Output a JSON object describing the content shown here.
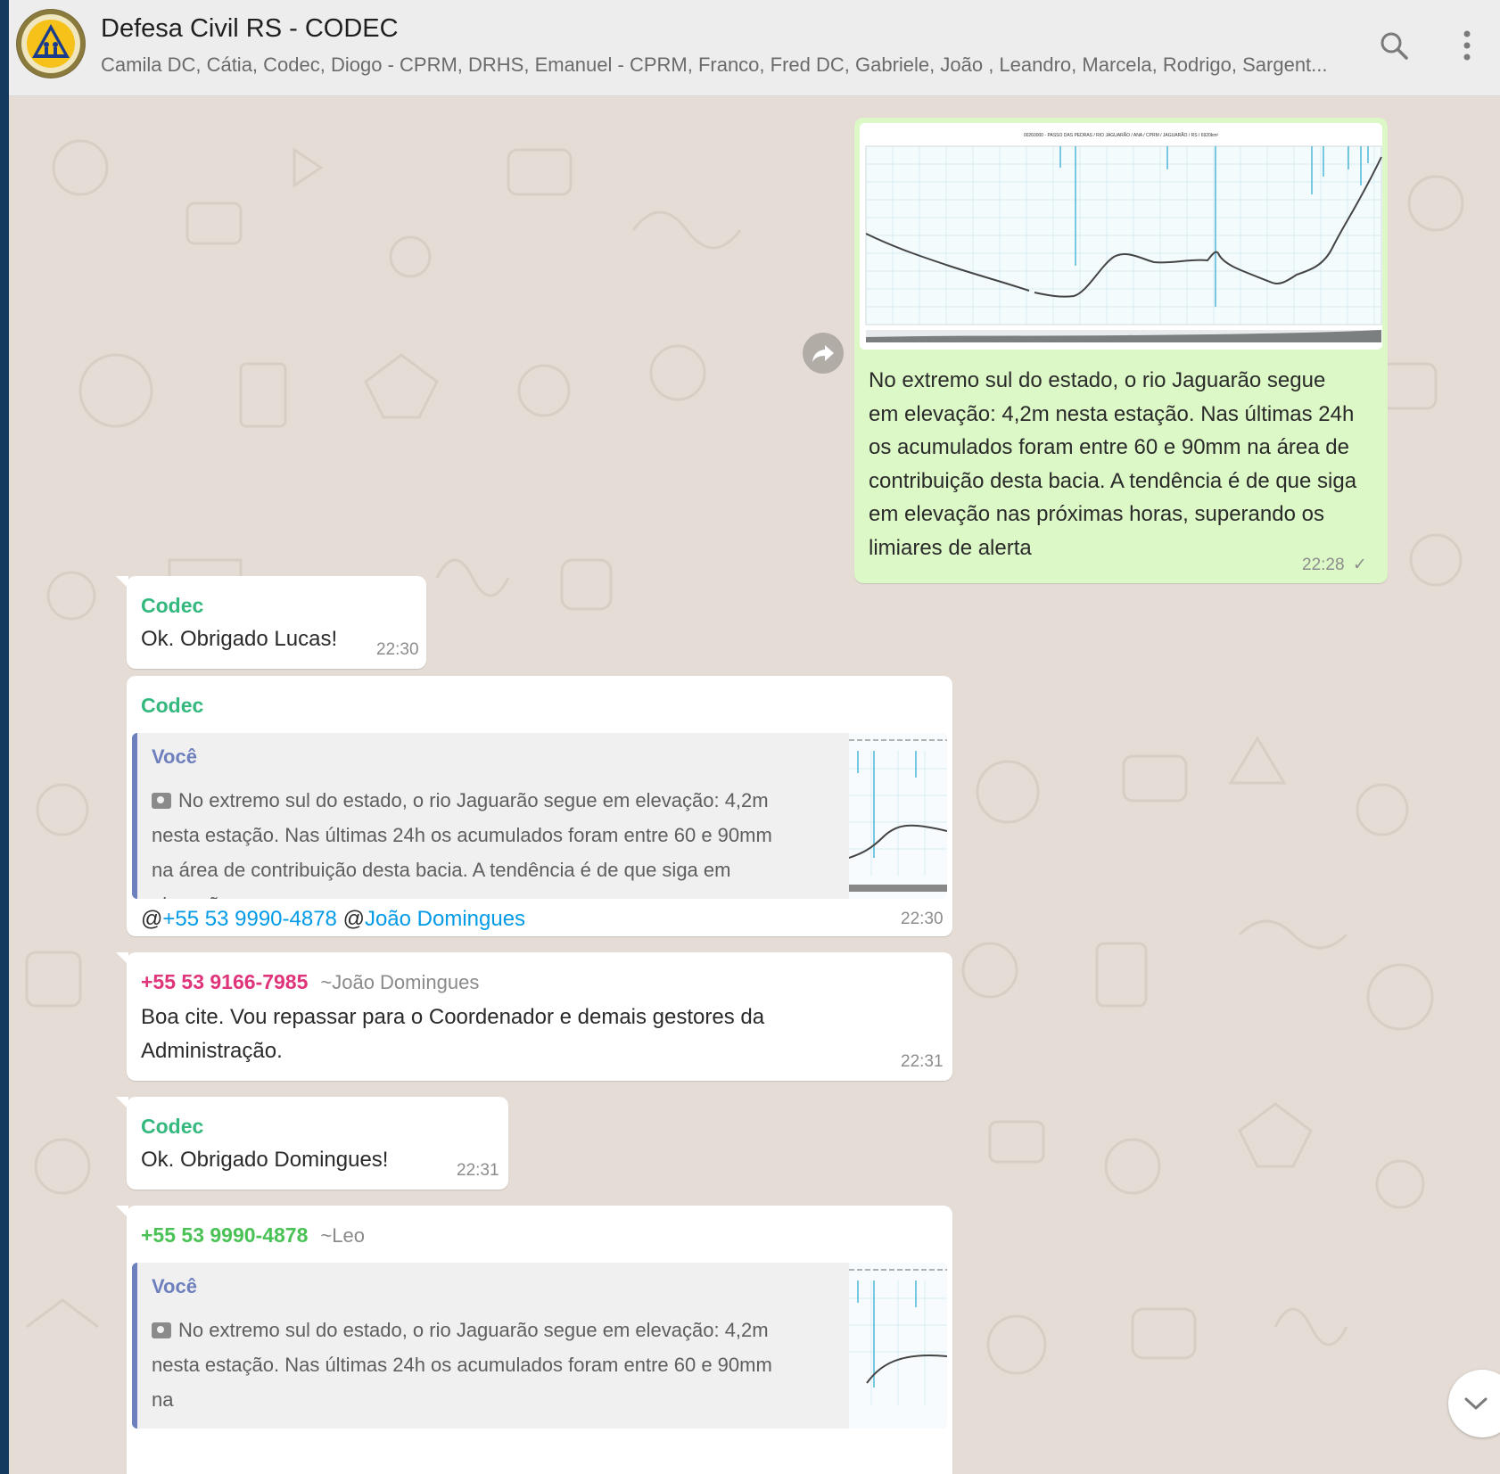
{
  "colors": {
    "header_bg": "#ededed",
    "chat_bg": "#e5ddd5",
    "outgoing_bubble": "#dcf8c6",
    "incoming_bubble": "#ffffff",
    "sender_codec": "#35b87e",
    "sender_pink": "#e0347a",
    "sender_green": "#4ac255",
    "mention": "#039be5",
    "quote_author": "#6d7fbd"
  },
  "header": {
    "title": "Defesa Civil RS - CODEC",
    "participants": "Camila DC, Cátia, Codec, Diogo - CPRM, DRHS, Emanuel - CPRM, Franco, Fred DC, Gabriele, João , Leandro, Marcela, Rodrigo, Sargent...",
    "icons": [
      "group-avatar",
      "search-icon",
      "menu-icon"
    ]
  },
  "messages": [
    {
      "direction": "out",
      "image_caption": "00260000 - PASSO DAS PEDRAS / RIO JAGUARÃO / ANA / CPRM / JAGUARÃO / RS / 6920km²",
      "text": "No extremo sul do estado, o rio Jaguarão segue em elevação: 4,2m nesta estação. Nas últimas 24h os acumulados foram entre 60 e 90mm na área de contribuição desta bacia. A tendência é de que siga em elevação nas próximas horas, superando os limiares de alerta",
      "time": "22:28",
      "status": "✓"
    },
    {
      "direction": "in",
      "sender": "Codec",
      "text": "Ok. Obrigado Lucas!",
      "time": "22:30"
    },
    {
      "direction": "in",
      "sender": "Codec",
      "quote_author": "Você",
      "quote_text": "No extremo sul do estado, o rio Jaguarão segue em elevação: 4,2m nesta estação. Nas últimas 24h os acumulados foram entre 60 e 90mm na área de contribuição desta bacia. A tendência é de que siga em elevaçã...",
      "mention_prefix_1": "@",
      "mention_1": "+55 53 9990-4878",
      "mention_prefix_2": "@",
      "mention_2": "João Domingues",
      "time": "22:30"
    },
    {
      "direction": "in",
      "sender": "+55 53 9166-7985",
      "sender_alias": "~João Domingues",
      "text": "Boa cite. Vou repassar para o Coordenador e demais gestores da Administração.",
      "time": "22:31"
    },
    {
      "direction": "in",
      "sender": "Codec",
      "text": "Ok. Obrigado Domingues!",
      "time": "22:31"
    },
    {
      "direction": "in",
      "sender": "+55 53 9990-4878",
      "sender_alias": "~Leo",
      "quote_author": "Você",
      "quote_text": "No extremo sul do estado, o rio Jaguarão segue em elevação: 4,2m nesta estação. Nas últimas 24h os acumulados foram entre 60 e 90mm na"
    }
  ]
}
